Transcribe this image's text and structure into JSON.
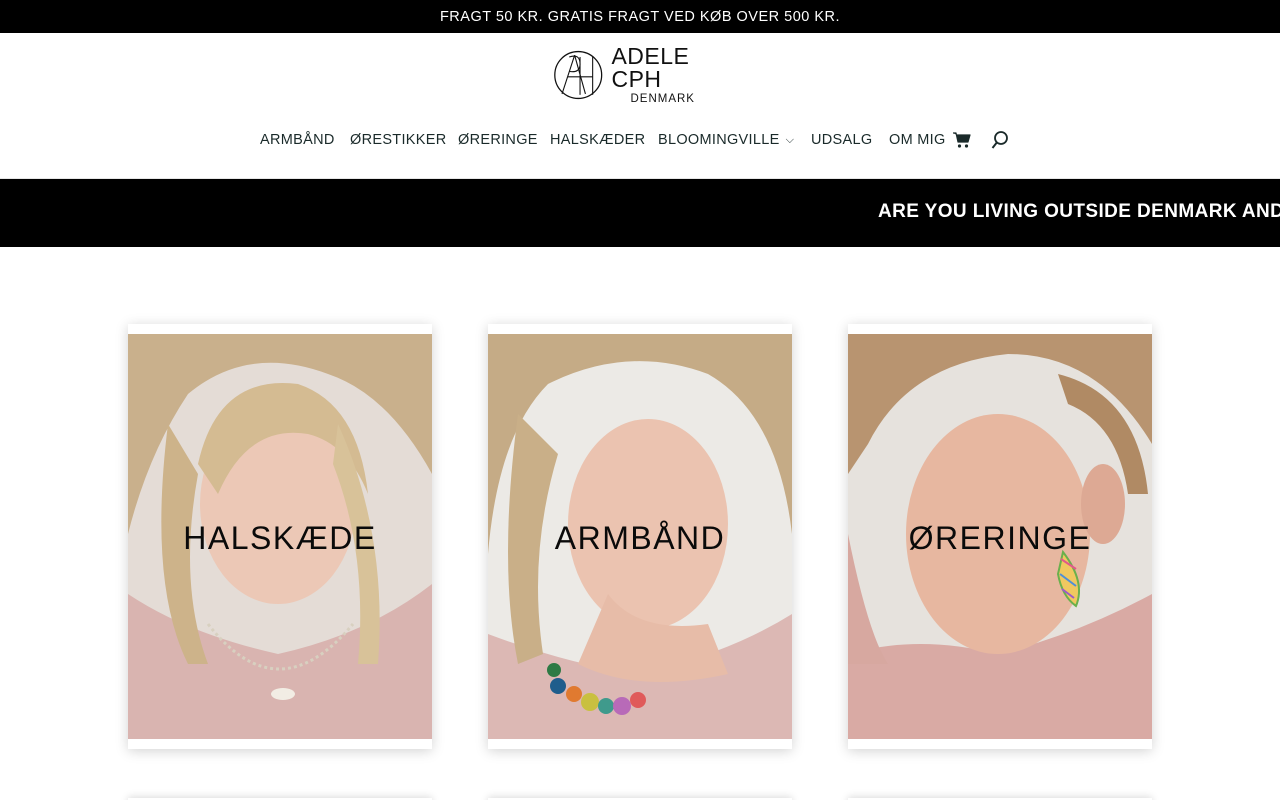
{
  "top_bar": {
    "text": "FRAGT 50 KR. GRATIS FRAGT VED KØB OVER 500 KR."
  },
  "logo": {
    "title": "ADELE CPH",
    "subtitle": "DENMARK"
  },
  "nav": {
    "items": [
      {
        "label": "ARMBÅND"
      },
      {
        "label": "ØRESTIKKER"
      },
      {
        "label": "ØRERINGE"
      },
      {
        "label": "HALSKÆDER"
      },
      {
        "label": "BLOOMINGVILLE",
        "has_dropdown": true
      },
      {
        "label": "UDSALG"
      },
      {
        "label": "OM MIG"
      }
    ],
    "cart_icon": "shopping-cart-icon",
    "search_icon": "search-icon"
  },
  "banner": {
    "text": "ARE YOU LIVING OUTSIDE DENMARK AND"
  },
  "categories": [
    {
      "label": "HALSKÆDE"
    },
    {
      "label": "ARMBÅND"
    },
    {
      "label": "ØRERINGE"
    }
  ],
  "colors": {
    "topbar_bg": "#000000",
    "banner_bg": "#000000",
    "nav_text": "#1a2a2a"
  }
}
